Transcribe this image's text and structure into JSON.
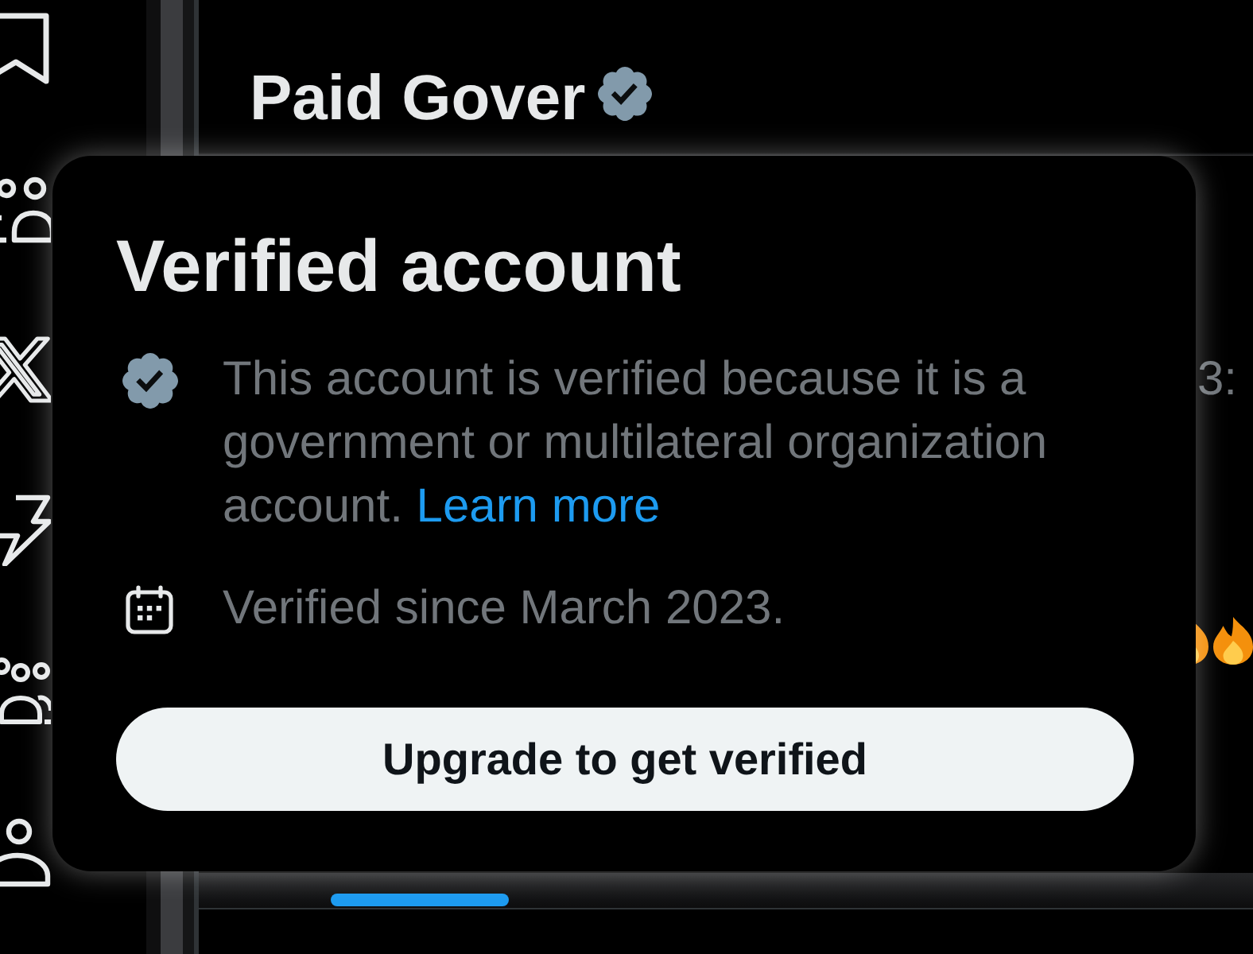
{
  "profile": {
    "name": "Paid Gover",
    "verified": true
  },
  "timeline": {
    "time_fragment": "3:"
  },
  "popup": {
    "title": "Verified account",
    "rows": [
      {
        "kind": "verified",
        "text": "This account is verified because it is a government or multilateral organization account.",
        "link": "Learn more"
      },
      {
        "kind": "date",
        "text": "Verified since March 2023."
      }
    ],
    "button": "Upgrade to get verified"
  }
}
